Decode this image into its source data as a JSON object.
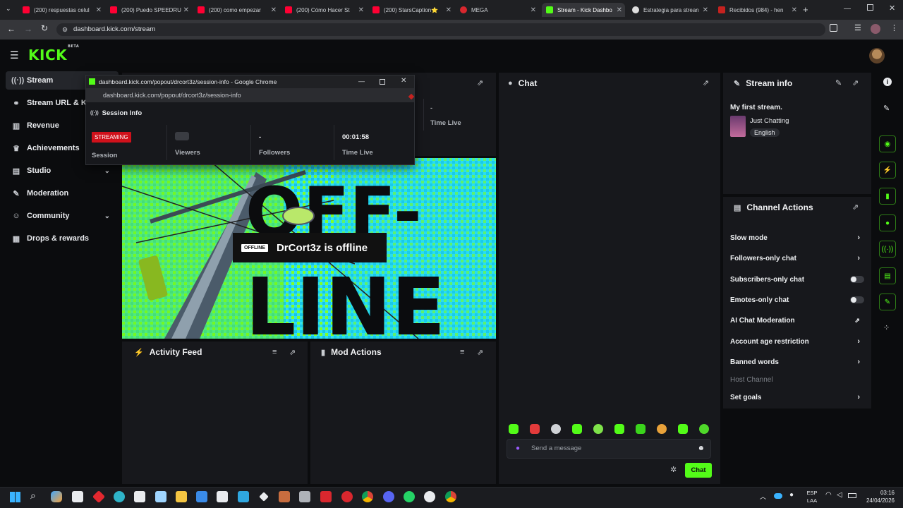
{
  "browser": {
    "tabs": [
      {
        "label": "(200) respuestas celul",
        "color": "#ff0033"
      },
      {
        "label": "(200) Puedo SPEEDRU",
        "color": "#ff0033"
      },
      {
        "label": "(200) como empezar",
        "color": "#ff0033"
      },
      {
        "label": "(200) Cómo Hacer St",
        "color": "#ff0033"
      },
      {
        "label": "(200) StarsCaption⭐",
        "color": "#ff0033"
      },
      {
        "label": "MEGA",
        "color": "#d9272e"
      },
      {
        "label": "Stream - Kick Dashbo",
        "color": "#53fc18"
      },
      {
        "label": "Estrategia para strean",
        "color": "#dddddd"
      },
      {
        "label": "Recibidos (984) - hen",
        "color": "#c5221f"
      }
    ],
    "url": "dashboard.kick.com/stream"
  },
  "kick": {
    "logo": "KICK",
    "logo_tag": "BETA"
  },
  "sidebar": {
    "items": [
      {
        "label": "Stream",
        "icon": "broadcast-icon"
      },
      {
        "label": "Stream URL & Ke",
        "icon": "link-icon"
      },
      {
        "label": "Revenue",
        "icon": "chart-icon"
      },
      {
        "label": "Achievements",
        "icon": "trophy-icon"
      },
      {
        "label": "Studio",
        "icon": "studio-icon"
      },
      {
        "label": "Moderation",
        "icon": "wrench-icon"
      },
      {
        "label": "Community",
        "icon": "people-icon"
      },
      {
        "label": "Drops & rewards",
        "icon": "gift-icon"
      }
    ]
  },
  "popout": {
    "window_title": "dashboard.kick.com/popout/drcort3z/session-info - Google Chrome",
    "url": "dashboard.kick.com/popout/drcort3z/session-info",
    "header": "Session Info",
    "status_badge": "STREAMING",
    "stats": [
      {
        "label": "Session",
        "value": ""
      },
      {
        "label": "Viewers",
        "value": ""
      },
      {
        "label": "Followers",
        "value": "-"
      },
      {
        "label": "Time Live",
        "value": "00:01:58"
      }
    ]
  },
  "session_behind": {
    "value": "-",
    "label": "Time Live"
  },
  "offline": {
    "badge": "OFFLINE",
    "message": "DrCort3z is offline"
  },
  "activity_feed": {
    "title": "Activity Feed"
  },
  "mod_actions": {
    "title": "Mod Actions"
  },
  "chat": {
    "title": "Chat",
    "placeholder": "Send a message",
    "send_label": "Chat"
  },
  "stream_info": {
    "title": "Stream info",
    "stream_title": "My first stream.",
    "category": "Just Chatting",
    "language": "English"
  },
  "channel_actions": {
    "title": "Channel Actions",
    "items": [
      {
        "label": "Slow mode",
        "control": "arrow"
      },
      {
        "label": "Followers-only chat",
        "control": "arrow"
      },
      {
        "label": "Subscribers-only chat",
        "control": "toggle"
      },
      {
        "label": "Emotes-only chat",
        "control": "toggle"
      },
      {
        "label": "AI Chat Moderation",
        "control": "external"
      },
      {
        "label": "Account age restriction",
        "control": "arrow"
      },
      {
        "label": "Banned words",
        "control": "arrow"
      },
      {
        "label": "Host Channel",
        "control": "none"
      },
      {
        "label": "Set goals",
        "control": "arrow"
      }
    ]
  },
  "taskbar": {
    "lang_top": "ESP",
    "lang_bottom": "LAA",
    "time": "03:16",
    "date": "24/04/2026"
  },
  "colors": {
    "brand": "#53fc18",
    "streaming_badge": "#d0111b"
  }
}
